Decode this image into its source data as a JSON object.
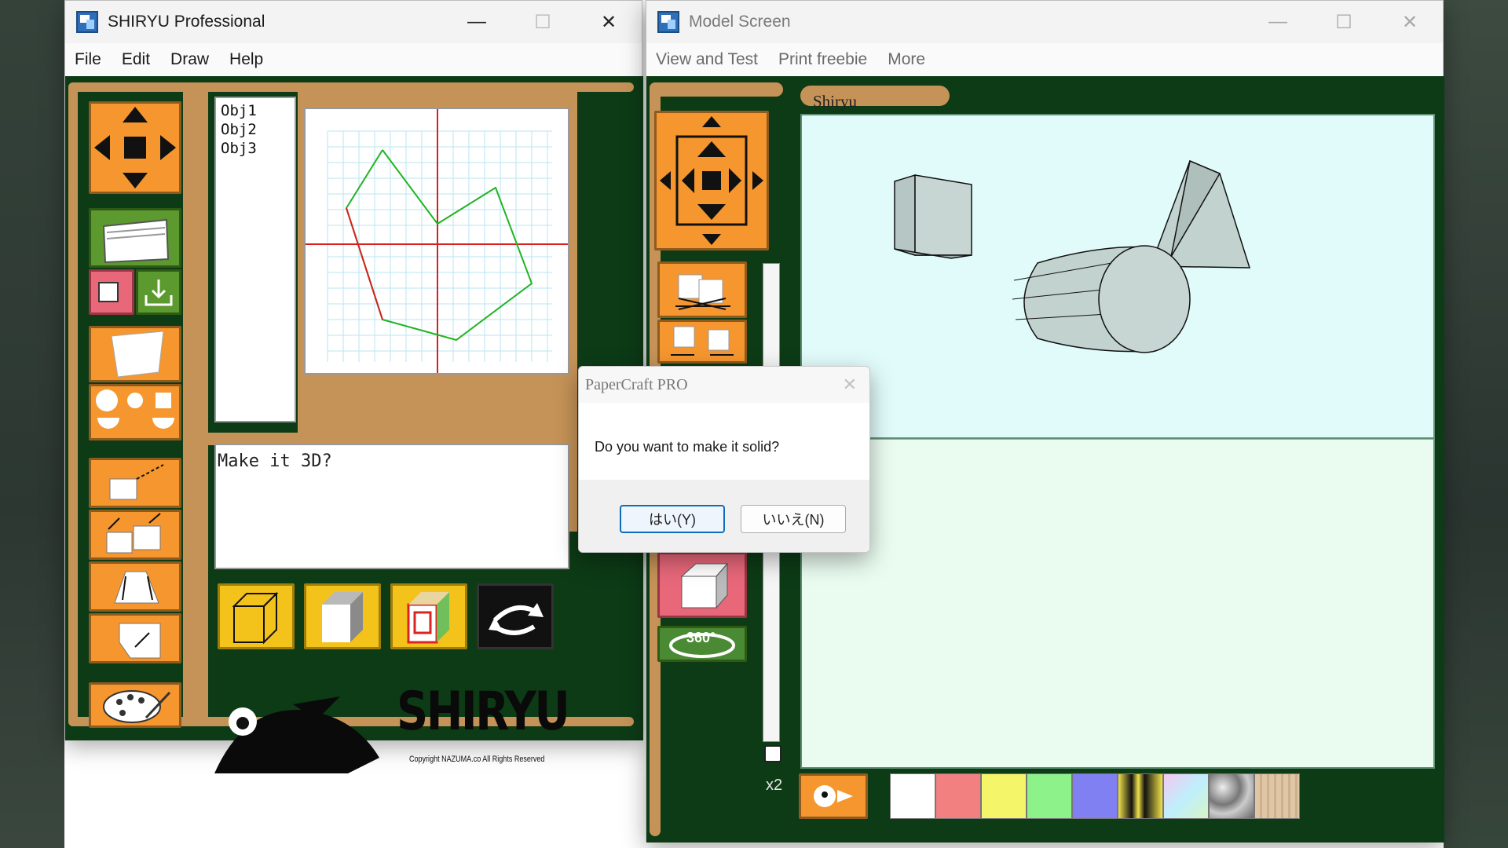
{
  "shiryu_window": {
    "title": "SHIRYU Professional",
    "menu": [
      "File",
      "Edit",
      "Draw",
      "Help"
    ],
    "objects": [
      "Obj1",
      "Obj2",
      "Obj3"
    ],
    "message": "Make it 3D?",
    "copyright": "Copyright NAZUMA.co All Rights Reserved",
    "logo_text": "SHIRYU"
  },
  "model_window": {
    "title": "Model Screen",
    "menu": [
      "View and Test",
      "Print freebie",
      "More"
    ],
    "view_label": "Shiryu",
    "zoom_label": "x2",
    "rotate_label": "360°",
    "swatches": [
      "#ffffff",
      "#f38080",
      "#f5f56a",
      "#8ef28a",
      "#8080f2"
    ]
  },
  "dialog": {
    "title": "PaperCraft PRO",
    "message": "Do you want to make it solid?",
    "yes_label": "はい(Y)",
    "no_label": "いいえ(N)"
  },
  "colors": {
    "panel_green": "#0d3b16",
    "tool_orange": "#f5962f",
    "tan": "#c59357",
    "accent_blue": "#0f6cbd"
  }
}
